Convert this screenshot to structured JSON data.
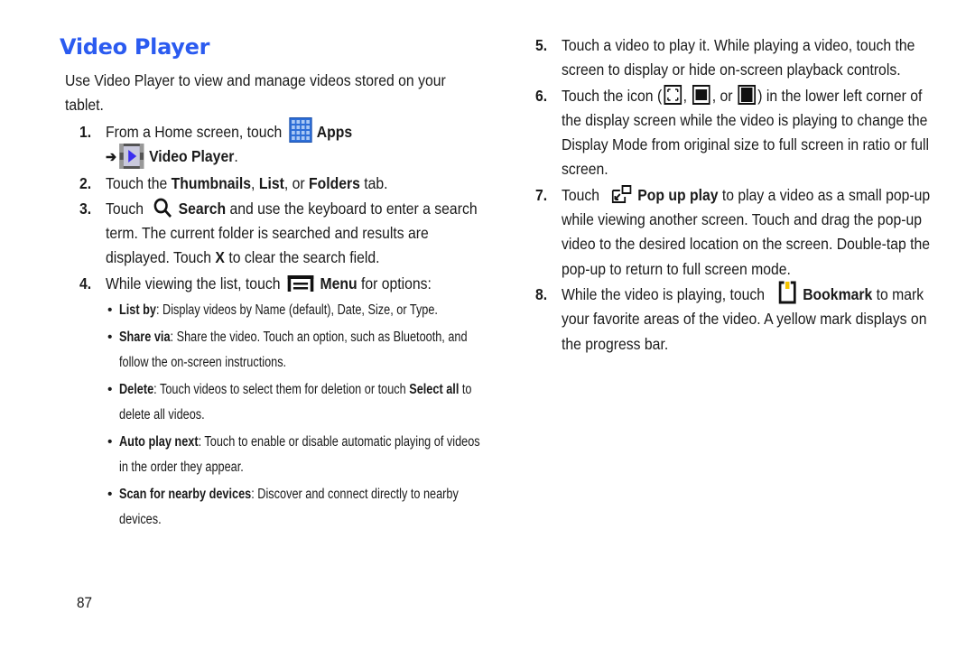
{
  "page": {
    "title": "Video Player",
    "title_color": "#2b5bf0",
    "intro": "Use Video Player to view and manage videos stored on your tablet.",
    "page_number": "87"
  },
  "steps": [
    {
      "num": "1.",
      "parts": {
        "a": "From a Home screen, touch ",
        "apps": "Apps",
        "arrow": "➔",
        "video_player": "Video Player",
        "end": "."
      },
      "icons": [
        "apps-icon",
        "video-player-icon"
      ]
    },
    {
      "num": "2.",
      "parts": {
        "a": "Touch the ",
        "thumbnails": "Thumbnails",
        "b": ", ",
        "list": "List",
        "c": ", or ",
        "folders": "Folders",
        "d": " tab."
      }
    },
    {
      "num": "3.",
      "parts": {
        "a": "Touch ",
        "search": "Search",
        "b": " and use the keyboard to enter a search term. The current folder is searched and results are displayed. Touch ",
        "x": "X",
        "c": " to clear the search field."
      },
      "icons": [
        "search-icon"
      ]
    },
    {
      "num": "4.",
      "parts": {
        "a": "While viewing the list, touch ",
        "menu": "Menu",
        "b": " for options:"
      },
      "icons": [
        "menu-icon"
      ],
      "bullets": [
        {
          "term": "List by",
          "text": ": Display videos by Name (default), Date, Size, or Type."
        },
        {
          "term": "Share via",
          "text": ": Share the video. Touch an option, such as Bluetooth, and follow the on-screen instructions."
        },
        {
          "term": "Delete",
          "text": ": Touch videos to select them for deletion or touch ",
          "term2": "Select all",
          "text2": " to delete all videos."
        },
        {
          "term": "Auto play next",
          "text": ": Touch to enable or disable automatic playing of videos in the order they appear."
        },
        {
          "term": "Scan for nearby devices",
          "text": ": Discover and connect directly to nearby devices."
        }
      ]
    },
    {
      "num": "5.",
      "parts": {
        "a": "Touch a video to play it. While playing a video, touch the screen to display or hide on-screen playback controls."
      }
    },
    {
      "num": "6.",
      "parts": {
        "a": "Touch the icon (",
        "b": ", ",
        "c": ", or ",
        "d": ") in the lower left corner of the display screen while the video is playing to change the Display Mode from original size to full screen in ratio or full screen."
      },
      "icons": [
        "original-size-icon",
        "full-screen-ratio-icon",
        "full-screen-icon"
      ]
    },
    {
      "num": "7.",
      "parts": {
        "a": "Touch ",
        "popup": "Pop up play",
        "b": " to play a video as a small pop-up while viewing another screen. Touch and drag the pop-up video to the desired location on the screen. Double-tap the pop-up to return to full screen mode."
      },
      "icons": [
        "pop-up-play-icon"
      ]
    },
    {
      "num": "8.",
      "parts": {
        "a": "While the video is playing, touch ",
        "bookmark": "Bookmark",
        "b": " to mark your favorite areas of the video. A yellow mark displays on the progress bar."
      },
      "icons": [
        "bookmark-icon"
      ]
    }
  ]
}
